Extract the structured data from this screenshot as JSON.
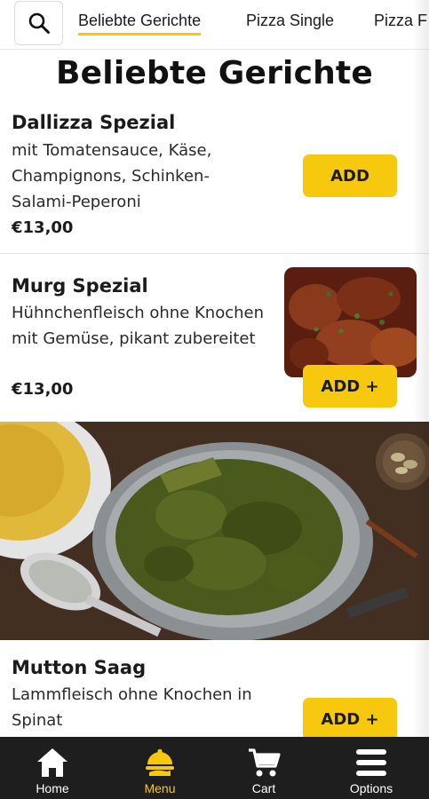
{
  "search": {
    "icon": "search-icon"
  },
  "tabs": [
    {
      "label": "Beliebte Gerichte",
      "active": true
    },
    {
      "label": "Pizza Single",
      "active": false
    },
    {
      "label": "Pizza F",
      "active": false
    }
  ],
  "page_title": "Beliebte Gerichte",
  "items": [
    {
      "name": "Dallizza Spezial",
      "description": "mit Tomatensauce, Käse, Champignons, Schinken-Salami-Peperoni",
      "price": "€13,00",
      "button": "ADD"
    },
    {
      "name": "Murg Spezial",
      "description": "Hühnchenfleisch ohne Knochen mit Gemüse, pikant zubereitet",
      "price": "€13,00",
      "button": "ADD +",
      "image": "chicken-curry-photo"
    },
    {
      "name": "Mutton Saag",
      "description": "Lammfleisch ohne Knochen in Spinat",
      "button": "ADD +",
      "image": "mutton-saag-photo"
    }
  ],
  "bottom_nav": [
    {
      "label": "Home",
      "icon": "home-icon",
      "active": false
    },
    {
      "label": "Menu",
      "icon": "menu-dish-icon",
      "active": true
    },
    {
      "label": "Cart",
      "icon": "cart-icon",
      "active": false
    },
    {
      "label": "Options",
      "icon": "options-icon",
      "active": false
    }
  ],
  "colors": {
    "accent": "#f6c90e",
    "nav_background": "#1e1e1e",
    "text": "#1b1b1b"
  }
}
